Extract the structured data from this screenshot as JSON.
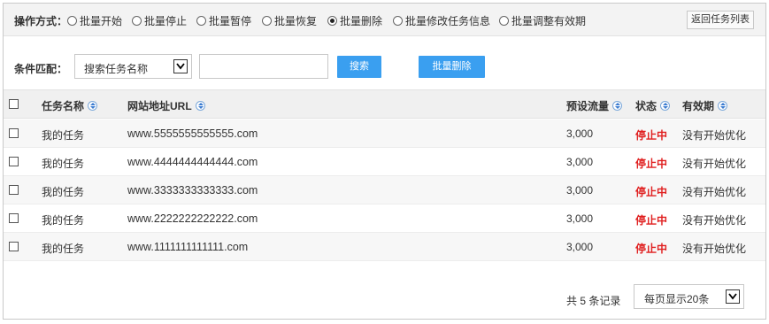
{
  "operation": {
    "label": "操作方式：",
    "options": [
      {
        "label": "批量开始",
        "checked": false
      },
      {
        "label": "批量停止",
        "checked": false
      },
      {
        "label": "批量暂停",
        "checked": false
      },
      {
        "label": "批量恢复",
        "checked": false
      },
      {
        "label": "批量删除",
        "checked": true
      },
      {
        "label": "批量修改任务信息",
        "checked": false
      },
      {
        "label": "批量调整有效期",
        "checked": false
      }
    ],
    "back_button": "返回任务列表"
  },
  "filter": {
    "label": "条件匹配：",
    "select_value": "搜索任务名称",
    "input_value": "",
    "search_button": "搜索",
    "bulk_delete_button": "批量删除"
  },
  "table": {
    "headers": {
      "name": "任务名称",
      "url": "网站地址URL",
      "traffic": "预设流量",
      "status": "状态",
      "validity": "有效期"
    },
    "rows": [
      {
        "name": "我的任务",
        "url": "www.5555555555555.com",
        "traffic": "3,000",
        "status": "停止中",
        "validity": "没有开始优化"
      },
      {
        "name": "我的任务",
        "url": "www.4444444444444.com",
        "traffic": "3,000",
        "status": "停止中",
        "validity": "没有开始优化"
      },
      {
        "name": "我的任务",
        "url": "www.3333333333333.com",
        "traffic": "3,000",
        "status": "停止中",
        "validity": "没有开始优化"
      },
      {
        "name": "我的任务",
        "url": "www.2222222222222.com",
        "traffic": "3,000",
        "status": "停止中",
        "validity": "没有开始优化"
      },
      {
        "name": "我的任务",
        "url": "www.1111111111111.com",
        "traffic": "3,000",
        "status": "停止中",
        "validity": "没有开始优化"
      }
    ]
  },
  "footer": {
    "total": "共 5 条记录",
    "page_size": "每页显示20条"
  },
  "colors": {
    "accent": "#3a9ff0",
    "status_stopped": "#e02020"
  },
  "icons": [
    "sort-icon",
    "chevron-down-icon",
    "checkbox-icon",
    "radio-icon"
  ]
}
